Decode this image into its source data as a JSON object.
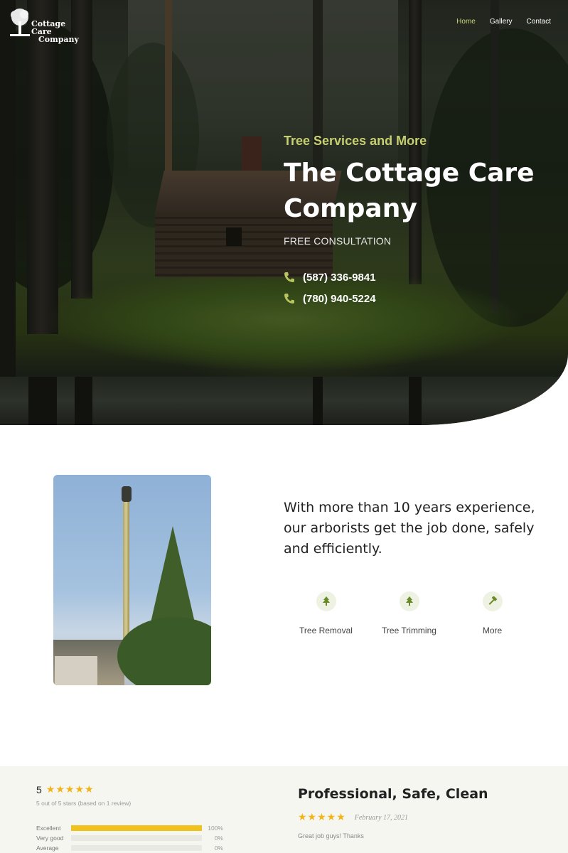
{
  "brand": {
    "name_line1": "Cottage Care",
    "name_line2": "Company"
  },
  "nav": {
    "items": [
      {
        "label": "Home",
        "active": true
      },
      {
        "label": "Gallery",
        "active": false
      },
      {
        "label": "Contact",
        "active": false
      }
    ]
  },
  "hero": {
    "tagline": "Tree Services and More",
    "title": "The Cottage Care Company",
    "consultation": "FREE CONSULTATION",
    "phones": [
      "(587) 336-9841",
      "(780) 940-5224"
    ]
  },
  "about": {
    "text": "With more than 10 years experience, our arborists get the job done, safely and efficiently.",
    "services": [
      {
        "label": "Tree Removal",
        "icon": "tree-icon"
      },
      {
        "label": "Tree Trimming",
        "icon": "tree-icon"
      },
      {
        "label": "More",
        "icon": "hammer-icon"
      }
    ]
  },
  "reviews": {
    "score": "5",
    "stars": "★★★★★",
    "summary": "5 out of 5 stars (based on 1 review)",
    "breakdown": [
      {
        "label": "Excellent",
        "percent": 100,
        "percent_label": "100%"
      },
      {
        "label": "Very good",
        "percent": 0,
        "percent_label": "0%"
      },
      {
        "label": "Average",
        "percent": 0,
        "percent_label": "0%"
      }
    ],
    "featured": {
      "title": "Professional, Safe, Clean",
      "stars": "★★★★★",
      "date": "February 17, 2021",
      "body": "Great job guys! Thanks"
    }
  },
  "colors": {
    "accent": "#c6cf72",
    "star": "#f2b418",
    "bar": "#f2c21c",
    "icon_green": "#6a8a2a"
  }
}
